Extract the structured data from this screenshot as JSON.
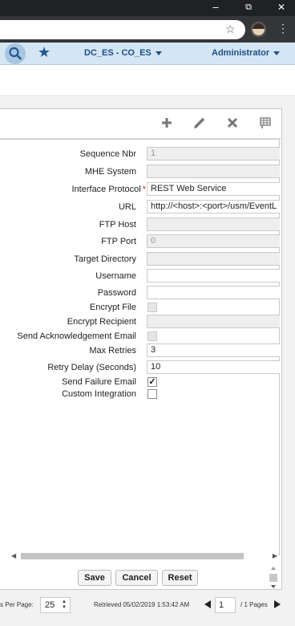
{
  "window": {
    "minimize_label": "–",
    "restore_label": "⧉",
    "close_label": "✕"
  },
  "browser": {
    "bookmark_icon": "star-outline-icon",
    "menu_label": "⋮"
  },
  "header": {
    "org_label": "DC_ES - CO_ES",
    "user_label": "Administrator"
  },
  "form": {
    "fields": {
      "sequence_nbr": {
        "label": "Sequence Nbr",
        "value": "1"
      },
      "mhe_system": {
        "label": "MHE System",
        "value": ""
      },
      "interface_protocol": {
        "label": "Interface Protocol",
        "required": "*",
        "value": "REST Web Service"
      },
      "url": {
        "label": "URL",
        "value": "http://<host>:<port>/usm/EventL"
      },
      "ftp_host": {
        "label": "FTP Host",
        "value": ""
      },
      "ftp_port": {
        "label": "FTP Port",
        "value": "0"
      },
      "target_directory": {
        "label": "Target Directory",
        "value": ""
      },
      "username": {
        "label": "Username",
        "value": ""
      },
      "password": {
        "label": "Password",
        "value": ""
      },
      "encrypt_file": {
        "label": "Encrypt File",
        "checked": false
      },
      "encrypt_recipient": {
        "label": "Encrypt Recipient",
        "value": ""
      },
      "send_ack_email": {
        "label": "Send Acknowledgement Email",
        "checked": false
      },
      "max_retries": {
        "label": "Max Retries",
        "value": "3"
      },
      "retry_delay": {
        "label": "Retry Delay (Seconds)",
        "value": "10"
      },
      "send_failure_email": {
        "label": "Send Failure Email",
        "checked": true,
        "mark": "✓"
      },
      "custom_integration": {
        "label": "Custom Integration",
        "checked": false
      }
    }
  },
  "buttons": {
    "save": "Save",
    "cancel": "Cancel",
    "reset": "Reset"
  },
  "footer": {
    "per_page_label": "s Per Page:",
    "per_page_value": "25",
    "retrieved": "Retrieved 05/02/2019 1:53:42 AM",
    "page_value": "1",
    "pages_label": "/ 1 Pages"
  },
  "colors": {
    "header_bg": "#d4e5f4",
    "accent": "#1f5a96"
  }
}
